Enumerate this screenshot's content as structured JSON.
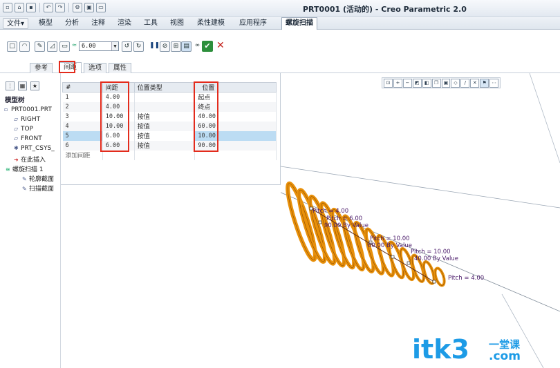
{
  "window": {
    "title": "PRT0001 (活动的) - Creo Parametric 2.0"
  },
  "quick_access": [
    "new-icon",
    "open-icon",
    "save-icon",
    "undo-icon",
    "redo-icon",
    "regenerate-icon",
    "windows-icon",
    "close-icon"
  ],
  "menu_tabs": [
    {
      "label": "文件▾"
    },
    {
      "label": "模型"
    },
    {
      "label": "分析"
    },
    {
      "label": "注释"
    },
    {
      "label": "渲染"
    },
    {
      "label": "工具"
    },
    {
      "label": "视图"
    },
    {
      "label": "柔性建模"
    },
    {
      "label": "应用程序"
    },
    {
      "label": "螺旋扫描"
    }
  ],
  "ribbon": {
    "pitch_value": "6.00",
    "dashboard_tabs": [
      {
        "label": "参考"
      },
      {
        "label": "间距"
      },
      {
        "label": "选项"
      },
      {
        "label": "属性"
      }
    ]
  },
  "model_tree": {
    "title": "模型树",
    "items": [
      {
        "label": "PRT0001.PRT",
        "icon": "part-icon"
      },
      {
        "label": "RIGHT",
        "icon": "datum-plane-icon"
      },
      {
        "label": "TOP",
        "icon": "datum-plane-icon"
      },
      {
        "label": "FRONT",
        "icon": "datum-plane-icon"
      },
      {
        "label": "PRT_CSYS_",
        "icon": "csys-icon"
      },
      {
        "label": "在此插入",
        "icon": "insert-arrow-icon"
      },
      {
        "label": "螺旋扫描 1",
        "icon": "helical-sweep-icon"
      },
      {
        "label": "轮廓截面",
        "icon": "sketch-icon"
      },
      {
        "label": "扫描截面",
        "icon": "sketch-icon"
      }
    ]
  },
  "spacing_table": {
    "headers": [
      "#",
      "间距",
      "位置类型",
      "位置"
    ],
    "rows": [
      {
        "n": "1",
        "pitch": "4.00",
        "type": "",
        "loc": "起点"
      },
      {
        "n": "2",
        "pitch": "4.00",
        "type": "",
        "loc": "终点"
      },
      {
        "n": "3",
        "pitch": "10.00",
        "type": "按值",
        "loc": "40.00"
      },
      {
        "n": "4",
        "pitch": "10.00",
        "type": "按值",
        "loc": "60.00"
      },
      {
        "n": "5",
        "pitch": "6.00",
        "type": "按值",
        "loc": "10.00"
      },
      {
        "n": "6",
        "pitch": "6.00",
        "type": "按值",
        "loc": "90.00"
      }
    ],
    "add_row_label": "添加间距"
  },
  "graphics": {
    "annotations": [
      {
        "text": "Pitch = 4.00"
      },
      {
        "text": "Pitch = 6.00"
      },
      {
        "text": "90.00 By Value"
      },
      {
        "text": "Pitch = 10.00"
      },
      {
        "text": "60.00 By Value"
      },
      {
        "text": "Pitch = 10.00"
      },
      {
        "text": "40.00 By Value"
      },
      {
        "text": "Pitch = 4.00"
      }
    ],
    "spring_color": "#e8900a"
  },
  "watermark": {
    "main": "itk3",
    "sub1": "一堂课",
    "sub2": ".com"
  }
}
